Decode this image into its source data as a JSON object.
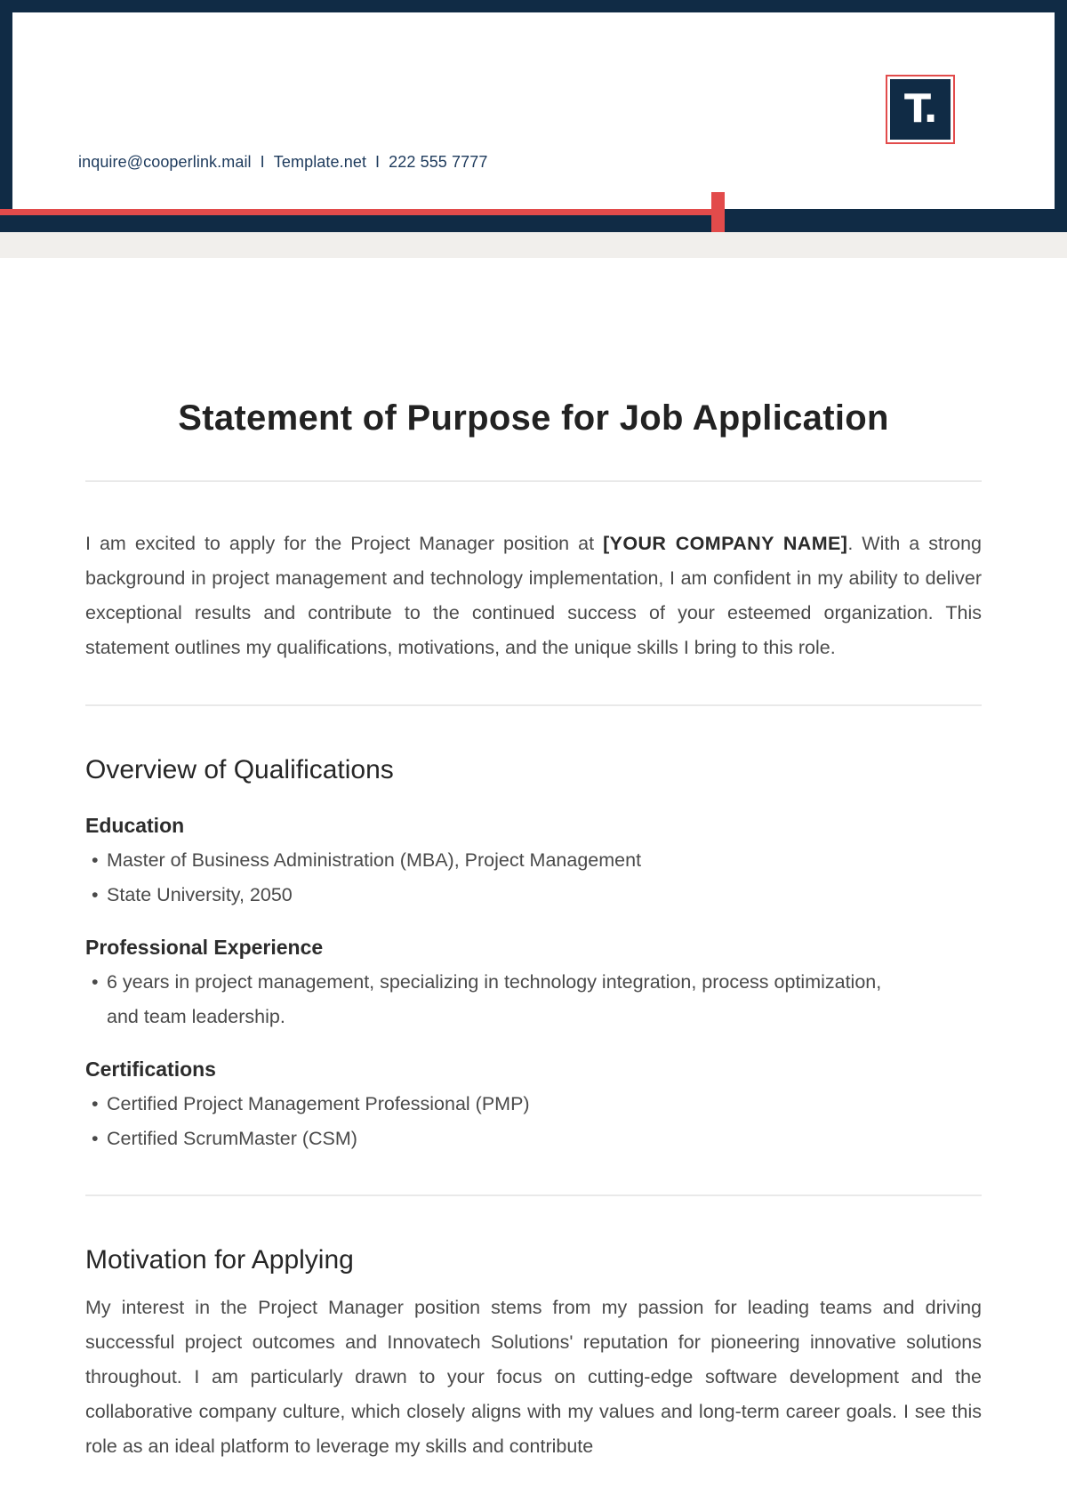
{
  "header": {
    "contact": {
      "email": "inquire@cooperlink.mail",
      "website": "Template.net",
      "phone": "222 555 7777",
      "separator": "I"
    },
    "logo": {
      "text": "T."
    }
  },
  "document": {
    "title": "Statement of Purpose for Job Application",
    "intro": {
      "before": "I am excited to apply for the Project Manager position at ",
      "company_placeholder": "[YOUR COMPANY NAME]",
      "after": ". With a strong background in project management and technology implementation, I am confident in my ability to deliver exceptional results and contribute to the continued success of your esteemed organization. This statement outlines my qualifications, motivations, and the unique skills I bring to this role."
    },
    "qualifications": {
      "title": "Overview of Qualifications",
      "education": {
        "title": "Education",
        "items": [
          "Master of Business Administration (MBA), Project Management",
          "State University, 2050"
        ]
      },
      "experience": {
        "title": "Professional Experience",
        "items": [
          "6 years in project management, specializing in technology integration, process optimization, and team leadership."
        ]
      },
      "certifications": {
        "title": "Certifications",
        "items": [
          "Certified Project Management Professional (PMP)",
          "Certified ScrumMaster (CSM)"
        ]
      }
    },
    "motivation": {
      "title": "Motivation for Applying",
      "text": "My interest in the Project Manager position stems from my passion for leading teams and driving successful project outcomes and Innovatech Solutions' reputation for pioneering innovative solutions throughout. I am particularly drawn to your focus on cutting-edge software development and the collaborative company culture, which closely aligns with my values and long-term career goals. I see this role as an ideal platform to leverage my skills and contribute"
    }
  },
  "colors": {
    "navy": "#102b45",
    "accent_red": "#e24b4b",
    "band_beige": "#f1efec",
    "contact_text": "#1d3a5c"
  }
}
